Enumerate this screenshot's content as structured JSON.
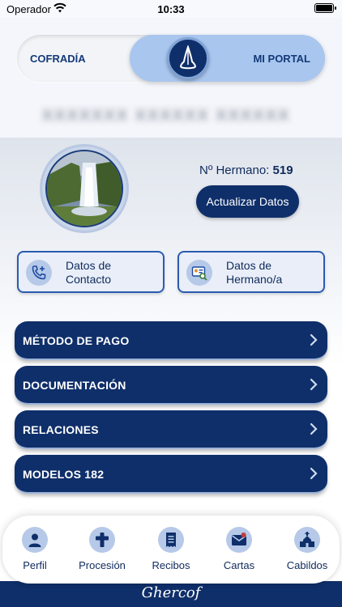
{
  "status_bar": {
    "carrier": "Operador",
    "time": "10:33",
    "wifi_icon": "wifi-icon",
    "battery_icon": "battery-icon"
  },
  "segment_toggle": {
    "left_label": "COFRADÍA",
    "right_label": "MI PORTAL",
    "selected": "MI PORTAL",
    "knob_icon": "capirote-icon"
  },
  "user": {
    "name_blurred": "XXXXXXX XXXXXX XXXXXX"
  },
  "profile": {
    "member_label": "Nº Hermano:",
    "member_number": "519",
    "update_button": "Actualizar Datos"
  },
  "cards": [
    {
      "line1": "Datos de",
      "line2": "Contacto",
      "icon": "phone-plus-icon"
    },
    {
      "line1": "Datos de",
      "line2": "Hermano/a",
      "icon": "id-card-search-icon"
    }
  ],
  "menu": [
    {
      "label": "MÉTODO DE PAGO"
    },
    {
      "label": "DOCUMENTACIÓN"
    },
    {
      "label": "RELACIONES"
    },
    {
      "label": "MODELOS 182"
    }
  ],
  "tabbar": [
    {
      "label": "Perfil",
      "icon": "user-icon"
    },
    {
      "label": "Procesión",
      "icon": "cross-icon"
    },
    {
      "label": "Recibos",
      "icon": "receipt-icon"
    },
    {
      "label": "Cartas",
      "icon": "mail-icon"
    },
    {
      "label": "Cabildos",
      "icon": "church-icon"
    }
  ],
  "footer": {
    "brand": "Ghercof"
  },
  "colors": {
    "primary": "#0f2f6a",
    "accent": "#a9c6ef",
    "card_border": "#2a5bb0",
    "icon_bg": "#b6c9e8"
  }
}
